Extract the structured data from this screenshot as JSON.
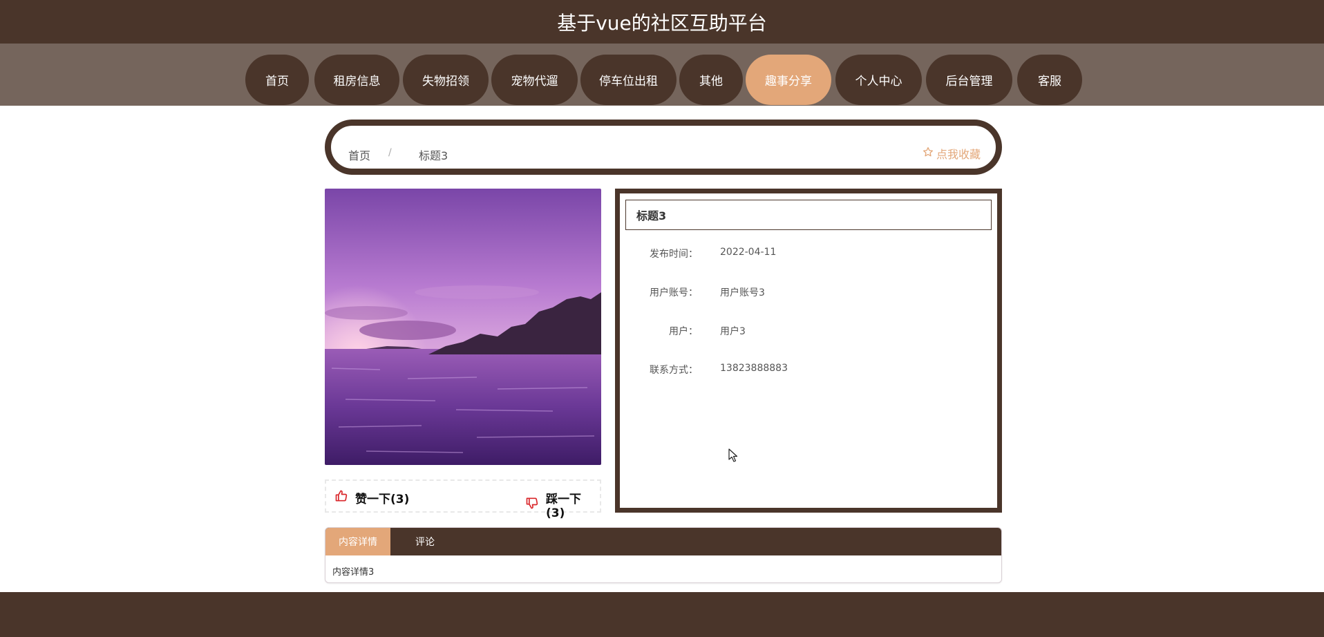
{
  "header": {
    "title": "基于vue的社区互助平台"
  },
  "nav": {
    "items": [
      {
        "label": "首页",
        "active": false
      },
      {
        "label": "租房信息",
        "active": false
      },
      {
        "label": "失物招领",
        "active": false
      },
      {
        "label": "宠物代遛",
        "active": false
      },
      {
        "label": "停车位出租",
        "active": false
      },
      {
        "label": "其他",
        "active": false
      },
      {
        "label": "趣事分享",
        "active": true
      },
      {
        "label": "个人中心",
        "active": false
      },
      {
        "label": "后台管理",
        "active": false
      },
      {
        "label": "客服",
        "active": false
      }
    ]
  },
  "breadcrumb": {
    "home": "首页",
    "separator": "/",
    "current": "标题3",
    "favorite": "点我收藏"
  },
  "votes": {
    "like": "赞一下(3)",
    "dislike": "踩一下(3)"
  },
  "detail": {
    "title": "标题3",
    "fields": [
      {
        "label": "发布时间：",
        "value": "2022-04-11"
      },
      {
        "label": "用户账号：",
        "value": "用户账号3"
      },
      {
        "label": "用户：",
        "value": "用户3"
      },
      {
        "label": "联系方式：",
        "value": "13823888883"
      }
    ]
  },
  "tabs": {
    "items": [
      {
        "label": "内容详情",
        "active": true
      },
      {
        "label": "评论",
        "active": false
      }
    ],
    "content": "内容详情3"
  },
  "colors": {
    "dark_brown": "#4a352a",
    "nav_bg": "#75655c",
    "accent": "#e3a779"
  },
  "icons": {
    "favorite": "star-outline-icon",
    "like": "thumbs-up-icon",
    "dislike": "thumbs-down-icon",
    "cursor": "mouse-pointer-icon"
  }
}
